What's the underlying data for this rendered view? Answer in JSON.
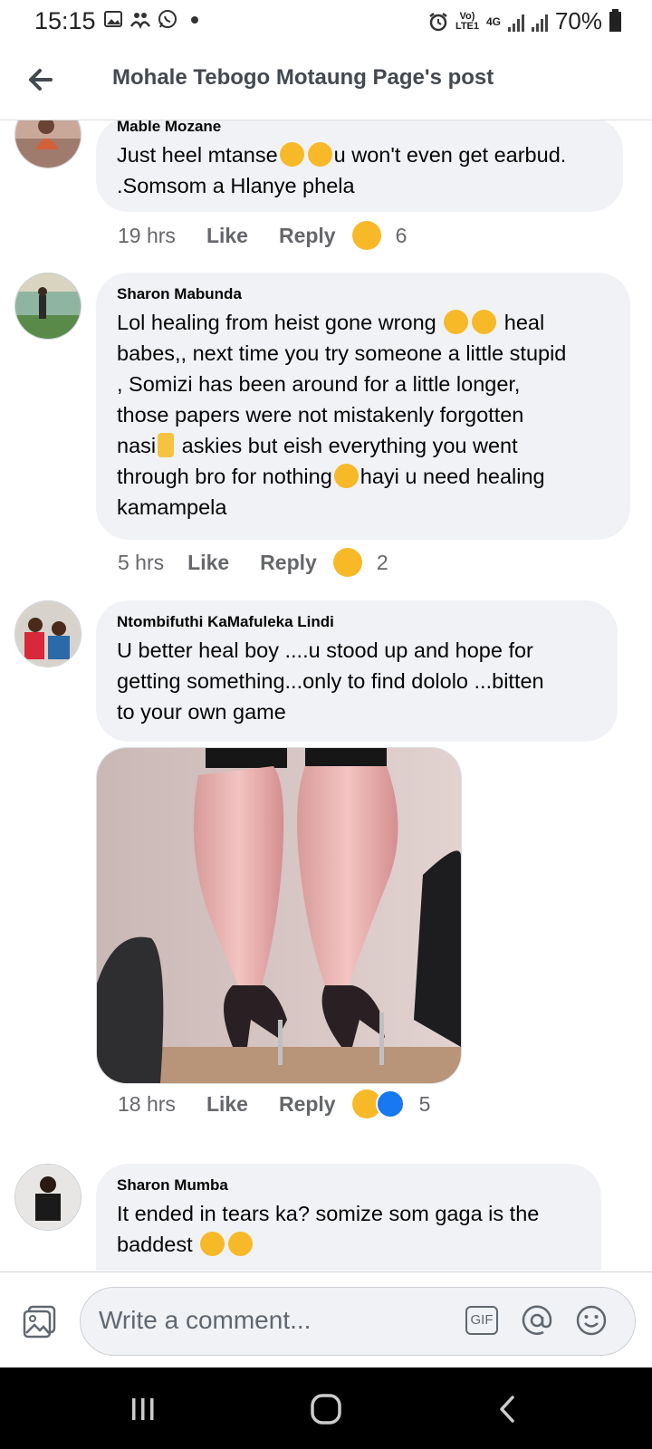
{
  "status_bar": {
    "time": "15:15",
    "battery": "70%",
    "network": "4G",
    "carrier_tag": "Vo) LTE1",
    "left_icons": [
      "gallery-icon",
      "people-icon",
      "whatsapp-icon",
      "dot-icon"
    ],
    "right_icons": [
      "alarm-icon",
      "volte-icon",
      "4g-icon",
      "signal-icon",
      "signal-icon",
      "battery-icon"
    ]
  },
  "header": {
    "title": "Mohale Tebogo Motaung Page's post",
    "back_icon": "back-arrow-icon"
  },
  "comments": [
    {
      "author": "Mable Mozane",
      "text_parts": [
        "Just heel mtanse",
        "",
        "u won't even get earbud.",
        ".Somsom a Hlanye phela"
      ],
      "time": "19 hrs",
      "like_label": "Like",
      "reply_label": "Reply",
      "reactions": [
        "haha"
      ],
      "reaction_count": "6"
    },
    {
      "author": "Sharon Mabunda",
      "lines": [
        "Lol healing from heist gone wrong",
        "heal",
        "babes,, next time you try someone a little stupid",
        ", Somizi has been around for a little longer,",
        "those papers were not mistakenly forgotten",
        "nasi",
        "askies but eish everything you went",
        "through bro for nothing",
        "hayi u need healing",
        "kamampela"
      ],
      "time": "5 hrs",
      "like_label": "Like",
      "reply_label": "Reply",
      "reactions": [
        "haha"
      ],
      "reaction_count": "2"
    },
    {
      "author": "Ntombifuthi KaMafuleka Lindi",
      "lines": [
        "U better heal boy ....u stood up and hope for",
        "getting something...only to find dololo ...bitten",
        "to your own game"
      ],
      "has_image": true,
      "time": "18 hrs",
      "like_label": "Like",
      "reply_label": "Reply",
      "reactions": [
        "haha",
        "like"
      ],
      "reaction_count": "5"
    },
    {
      "author": "Sharon Mumba",
      "lines": [
        "It ended in tears ka? somize som gaga is the",
        "baddest"
      ]
    }
  ],
  "composer": {
    "placeholder": "Write a comment...",
    "gif_label": "GIF"
  },
  "colors": {
    "bubble": "#f0f2f5",
    "meta_text": "#65676b",
    "like_blue": "#1877f2",
    "haha_yellow": "#f7b928"
  }
}
